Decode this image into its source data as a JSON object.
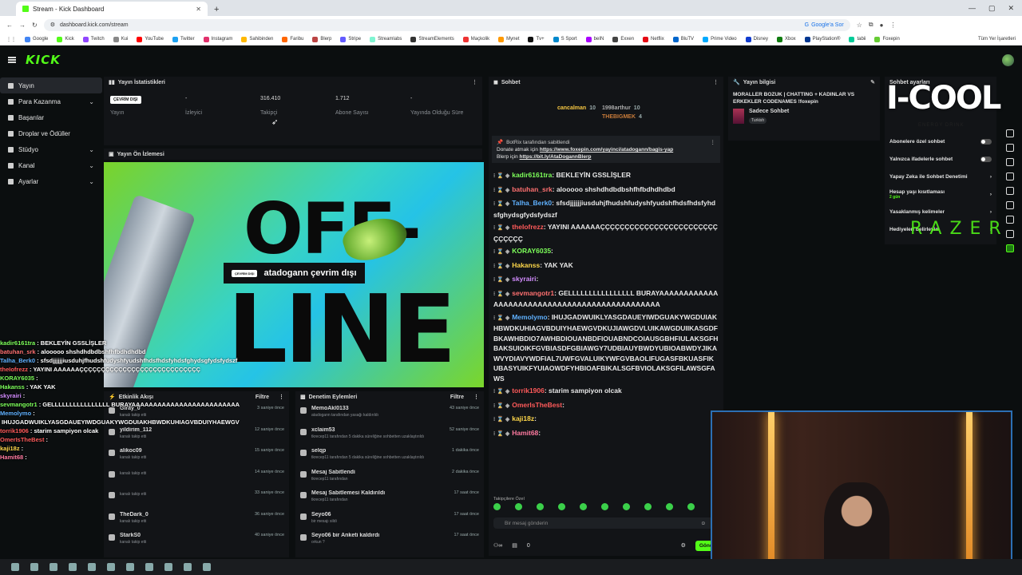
{
  "browser": {
    "tab_title": "Stream - Kick Dashboard",
    "new_tab": "+",
    "url": "dashboard.kick.com/stream",
    "google_search": "Google'a Sor",
    "bookmarks": [
      "Google",
      "Kick",
      "Twitch",
      "Kui",
      "YouTube",
      "Twitter",
      "Instagram",
      "Sahibinden",
      "Faribu",
      "Blerp",
      "Stripe",
      "Streamlabs",
      "StreamElements",
      "Maçkolik",
      "Mynet",
      "Tv+",
      "S Sport",
      "beIN",
      "Exxen",
      "Netflix",
      "BluTV",
      "Prime Video",
      "Disney",
      "Xbox",
      "PlayStation®",
      "tabii",
      "Foxepin"
    ],
    "bookmarks_right": "Tüm Yer İşaretleri"
  },
  "app": {
    "logo": "KICK"
  },
  "sidebar": {
    "items": [
      {
        "label": "Yayın",
        "active": true,
        "chevron": ""
      },
      {
        "label": "Para Kazanma",
        "chevron": "⌄"
      },
      {
        "label": "Başarılar",
        "chevron": ""
      },
      {
        "label": "Droplar ve Ödüller",
        "chevron": ""
      },
      {
        "label": "Stüdyo",
        "chevron": "⌄"
      },
      {
        "label": "Kanal",
        "chevron": "⌄"
      },
      {
        "label": "Ayarlar",
        "chevron": "⌄"
      }
    ]
  },
  "stats": {
    "title": "Yayın İstatistikleri",
    "items": [
      {
        "value": "",
        "label": "Yayın",
        "badge": "ÇEVRİM DIŞI"
      },
      {
        "value": "-",
        "label": "İzleyici"
      },
      {
        "value": "316.410",
        "label": "Takipçi"
      },
      {
        "value": "1.712",
        "label": "Abone Sayısı"
      },
      {
        "value": "-",
        "label": "Yayında Olduğu Süre"
      }
    ]
  },
  "preview": {
    "title": "Yayın Ön İzlemesi",
    "offline_badge": "ÇEVRİM DIŞI",
    "offline_text": "atadogann çevrim dışı",
    "art_off": "OFF-",
    "art_line": "LINE"
  },
  "overlay_chat": [
    {
      "user": "kadir6161tra",
      "color": "#7dff5a",
      "text": ": BEKLEYİN GSSLİŞLER"
    },
    {
      "user": "batuhan_srk",
      "color": "#ff7070",
      "text": ": alooooo shshdhdbdbshfhfbdhdhdbd"
    },
    {
      "user": "Talha_Berk0",
      "color": "#5fb1ff",
      "text": ": sfsdjjjjjjiusduhjfhudshfudyshfyudshfhdsfhdsfyhdsfghydsgfydsfydszf"
    },
    {
      "user": "theIofrezz",
      "color": "#ff5a5a",
      "text": ": YAYINI AAAAAAÇÇÇÇÇÇÇÇÇÇÇÇÇÇÇÇÇÇÇÇÇÇÇÇÇÇÇÇ"
    },
    {
      "user": "KORAY6035",
      "color": "#7dff5a",
      "text": ":"
    },
    {
      "user": "Hakanss",
      "color": "#7dff5a",
      "text": ":  YAK  YAK"
    },
    {
      "user": "skyrairi",
      "color": "#d38cff",
      "text": ":"
    },
    {
      "user": "sevmangotr1",
      "color": "#7dff5a",
      "text": ": GELLLLLLLLLLLLLLLL BURAYAAAAAAAAAAAAAAAAAAAAAAAAAAAAAAAAAAAAAA"
    },
    {
      "user": "Memolymo",
      "color": "#5fb1ff",
      "text": ":"
    },
    {
      "user": "",
      "color": "#fff",
      "text": "IHUJGADWUIKLYASGDAUEYIWDGUAKYWGDUIAKHBWDKUHIAGVBDUIYHAEWGVDKUJIAWGDVLUIKAWGDUIIKASGDFBKAWHBDIO7AWHBDIOUANBDFIOUABNDCOIAUSGBHFIULAKSGFBHAKWBDIOBWDYUJKAWVYDIAVYWDFIAL7UWFGVALSIFKUBASYUIKFYUIAOWDFYHBIOAFBIKALSGFBVIOLAKSGFILAWSGFAWS"
    },
    {
      "user": "torrik1906",
      "color": "#ff5a5a",
      "text": ": starim sampiyon olcak"
    },
    {
      "user": "OmerIsTheBest",
      "color": "#ff5a5a",
      "text": ":"
    },
    {
      "user": "kaji18z",
      "color": "#ffd84a",
      "text": ":"
    },
    {
      "user": "Hamit68",
      "color": "#ff7aa0",
      "text": ":"
    }
  ],
  "activity": {
    "title": "Etkinlik Akışı",
    "filter": "Filtre",
    "rows": [
      {
        "name": "Giray_0",
        "sub": "kanalı takip etti",
        "time": "3 saniye önce"
      },
      {
        "name": "yildirim_112",
        "sub": "kanalı takip etti",
        "time": "12 saniye önce"
      },
      {
        "name": "alikoc09",
        "sub": "kanalı takip etti",
        "time": "15 saniye önce"
      },
      {
        "name": "",
        "sub": "kanalı takip etti",
        "time": "14 saniye önce"
      },
      {
        "name": "",
        "sub": "kanalı takip etti",
        "time": "33 saniye önce"
      },
      {
        "name": "TheDark_0",
        "sub": "kanalı takip etti",
        "time": "36 saniye önce"
      },
      {
        "name": "StarkS0",
        "sub": "kanalı takip etti",
        "time": "40 saniye önce"
      }
    ]
  },
  "moderation": {
    "title": "Denetim Eylemleri",
    "filter": "Filtre",
    "rows": [
      {
        "name": "MemoAkl0133",
        "sub": "atadogann tarafından yasağı kaldırıldı",
        "time": "43 saniye önce"
      },
      {
        "name": "xclaim53",
        "sub": "tkrecep11 tarafından 5 dakika süreliğine sohbetten uzaklaştırıldı",
        "time": "52 saniye önce"
      },
      {
        "name": "selqp",
        "sub": "tkrecep11 tarafından 5 dakika süreliğine sohbetten uzaklaştırıldı",
        "time": "1 dakika önce"
      },
      {
        "name": "Mesaj Sabitlendi",
        "sub": "tkrecep11 tarafından",
        "time": "2 dakika önce"
      },
      {
        "name": "Mesaj Sabitlemesi Kaldırıldı",
        "sub": "tkrecep11 tarafından",
        "time": "17 saat önce"
      },
      {
        "name": "Seyo06",
        "sub": "bir mesajı sildi",
        "time": "17 saat önce"
      },
      {
        "name": "Seyo06 bir Anketi kaldırdı",
        "sub": "orkun ?",
        "time": "17 saat önce"
      }
    ]
  },
  "chat": {
    "title": "Sohbet",
    "gifters": [
      {
        "name": "cancalman",
        "count": "10"
      },
      {
        "name": "1998arthur",
        "count": "10"
      },
      {
        "name": "THEBIGMEK",
        "count": "4"
      }
    ],
    "pinned": {
      "by": "BotRix tarafından sabitlendi",
      "line1_prefix": "Donate atmak için ",
      "line1_link": "https://www.foxepin.com/yayinci/atadogann/bagis-yap",
      "line2_prefix": "Blerp için ",
      "line2_link": "https://bit.ly/AtaDogannBlerp"
    },
    "messages": [
      {
        "user": "kadir6161tra",
        "color": "#7dff5a",
        "text": ": BEKLEYİN GSSLİŞLER"
      },
      {
        "user": "batuhan_srk",
        "color": "#ff7070",
        "text": ": alooooo shshdhdbdbshfhfbdhdhdbd"
      },
      {
        "user": "Talha_Berk0",
        "color": "#5fb1ff",
        "text": ": sfsdjjjjjjiusduhjfhudshfudyshfyudshfhdsfhdsfyhdsfghydsgfydsfydszf"
      },
      {
        "user": "theIofrezz",
        "color": "#ff5a5a",
        "text": ": YAYINI AAAAAAÇÇÇÇÇÇÇÇÇÇÇÇÇÇÇÇÇÇÇÇÇÇÇÇÇÇÇÇÇÇ"
      },
      {
        "user": "KORAY6035",
        "color": "#7dff5a",
        "text": ":"
      },
      {
        "user": "Hakanss",
        "color": "#ffd84a",
        "text": ": YAK YAK"
      },
      {
        "user": "skyrairi",
        "color": "#d38cff",
        "text": ":"
      },
      {
        "user": "sevmangotr1",
        "color": "#ff7070",
        "text": ": GELLLLLLLLLLLLLLLL BURAYAAAAAAAAAAAAAAAAAAAAAAAAAAAAAAAAAAAAAAAAAAAAAA"
      },
      {
        "user": "Memolymo",
        "color": "#5fb1ff",
        "text": ": IHUJGADWUIKLYASGDAUEYIWDGUAKYWGDUIAKHBWDKUHIAGVBDUIYHAEWGVDKUJIAWGDVLUIKAWGDUIIKASGDFBKAWHBDIO7AWHBDIOUANBDFIOUABNDCOIAUSGBHFIULAKSGFHBAKSUIOIKFGVBIASDFGBIAWGY7UDBIAUYBWDYUBIOABWDYJIKAWVYDIAVYWDFIAL7UWFGVALUIKYWFGVBAOLIFUGASFBKUASFIKUBASYUIKFYUIAOWDFYHBIOAFBIKALSGFBVIOLAKSGFILAWSGFAWS"
      },
      {
        "user": "torrik1906",
        "color": "#ff5a5a",
        "text": ": starim sampiyon olcak"
      },
      {
        "user": "OmerIsTheBest",
        "color": "#ff5a5a",
        "text": ":"
      },
      {
        "user": "kaji18z",
        "color": "#ffd84a",
        "text": ":"
      },
      {
        "user": "Hamit68",
        "color": "#ff7aa0",
        "text": ":"
      }
    ],
    "followers_only": "Takipçilere Özel",
    "input_placeholder": "Bir mesaj gönderin",
    "counter": "0",
    "send": "Gönder"
  },
  "stream_info": {
    "title_label": "Yayın bilgisi",
    "title": "MORALLER BOZUK | CHATTING + KADINLAR VS ERKEKLER CODENAMES !foxepin",
    "category": "Sadece Sohbet",
    "tag": "Turkish"
  },
  "chat_settings": {
    "title": "Sohbet ayarları",
    "items": [
      {
        "label": "Abonelere özel sohbet",
        "type": "toggle"
      },
      {
        "label": "Yalnızca ifadelerle sohbet",
        "type": "toggle"
      },
      {
        "label": "Yapay Zeka ile Sohbet Denetimi",
        "type": "link"
      },
      {
        "label": "Hesap yaşı kısıtlaması",
        "sub": "2 gün",
        "type": "chevron"
      },
      {
        "label": "Yasaklanmış kelimeler",
        "type": "chevron"
      },
      {
        "label": "Hediyeleri belirleyin",
        "type": "chevron"
      }
    ]
  },
  "overlay_brand": {
    "icool": "I-COOL",
    "icool_sub": "ENERGY DRINK",
    "razer": "RAZER"
  }
}
